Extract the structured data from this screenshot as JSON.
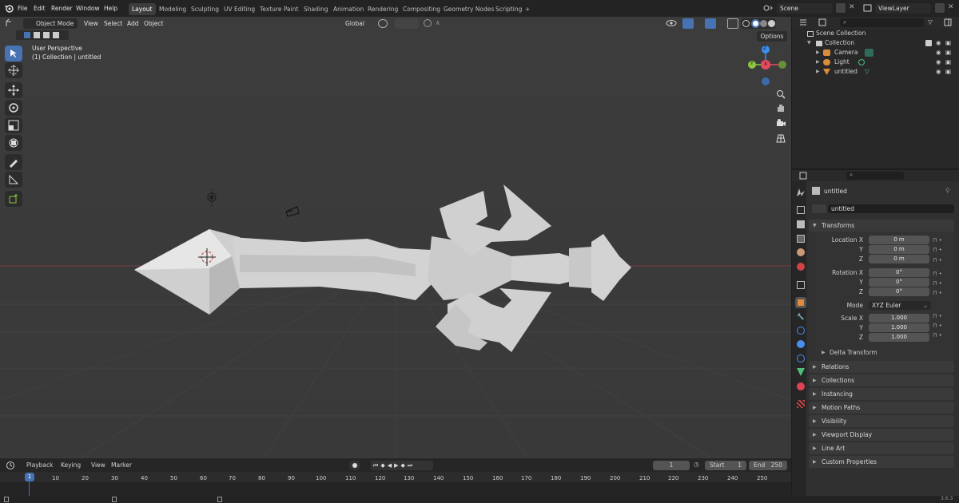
{
  "topbar": {
    "menus": [
      "File",
      "Edit",
      "Render",
      "Window",
      "Help"
    ],
    "workspaces": [
      "Layout",
      "Modeling",
      "Sculpting",
      "UV Editing",
      "Texture Paint",
      "Shading",
      "Animation",
      "Rendering",
      "Compositing",
      "Geometry Nodes",
      "Scripting"
    ],
    "active_workspace": "Layout",
    "add_tab": "+",
    "scene": "Scene",
    "view_layer": "ViewLayer"
  },
  "viewport": {
    "mode": "Object Mode",
    "menus": [
      "View",
      "Select",
      "Add",
      "Object"
    ],
    "orientation": "Global",
    "options_label": "Options",
    "overlay_line1": "User Perspective",
    "overlay_line2": "(1) Collection | untitled",
    "gizmo": {
      "x": "X",
      "y": "Y",
      "z": "Z"
    }
  },
  "outliner": {
    "root": "Scene Collection",
    "collection": "Collection",
    "items": [
      {
        "name": "Camera",
        "icon": "camera-icon"
      },
      {
        "name": "Light",
        "icon": "light-icon"
      },
      {
        "name": "untitled",
        "icon": "mesh-icon"
      }
    ]
  },
  "properties": {
    "object_name": "untitled",
    "datablock_name": "untitled",
    "transforms_title": "Transforms",
    "location": {
      "label_x": "Location X",
      "label_y": "Y",
      "label_z": "Z",
      "x": "0 m",
      "y": "0 m",
      "z": "0 m"
    },
    "rotation": {
      "label_x": "Rotation X",
      "label_y": "Y",
      "label_z": "Z",
      "x": "0°",
      "y": "0°",
      "z": "0°"
    },
    "mode_label": "Mode",
    "mode_value": "XYZ Euler",
    "scale": {
      "label_x": "Scale X",
      "label_y": "Y",
      "label_z": "Z",
      "x": "1.000",
      "y": "1.000",
      "z": "1.000"
    },
    "delta_transform": "Delta Transform",
    "panels": [
      "Relations",
      "Collections",
      "Instancing",
      "Motion Paths",
      "Visibility",
      "Viewport Display",
      "Line Art",
      "Custom Properties"
    ]
  },
  "timeline": {
    "menus": [
      "Playback",
      "Keying",
      "View",
      "Marker"
    ],
    "current_frame": "1",
    "start_label": "Start",
    "start_value": "1",
    "end_label": "End",
    "end_value": "250",
    "ruler": [
      "1",
      "10",
      "20",
      "30",
      "40",
      "50",
      "60",
      "70",
      "80",
      "90",
      "100",
      "110",
      "120",
      "130",
      "140",
      "150",
      "160",
      "170",
      "180",
      "190",
      "200",
      "210",
      "220",
      "230",
      "240",
      "250"
    ],
    "version": "3.6.3"
  },
  "colors": {
    "accent": "#4772b3",
    "x_axis": "#e84a5f",
    "y_axis": "#8cc63e",
    "z_axis": "#3b8ff0",
    "sword": "#d9d9d9"
  }
}
